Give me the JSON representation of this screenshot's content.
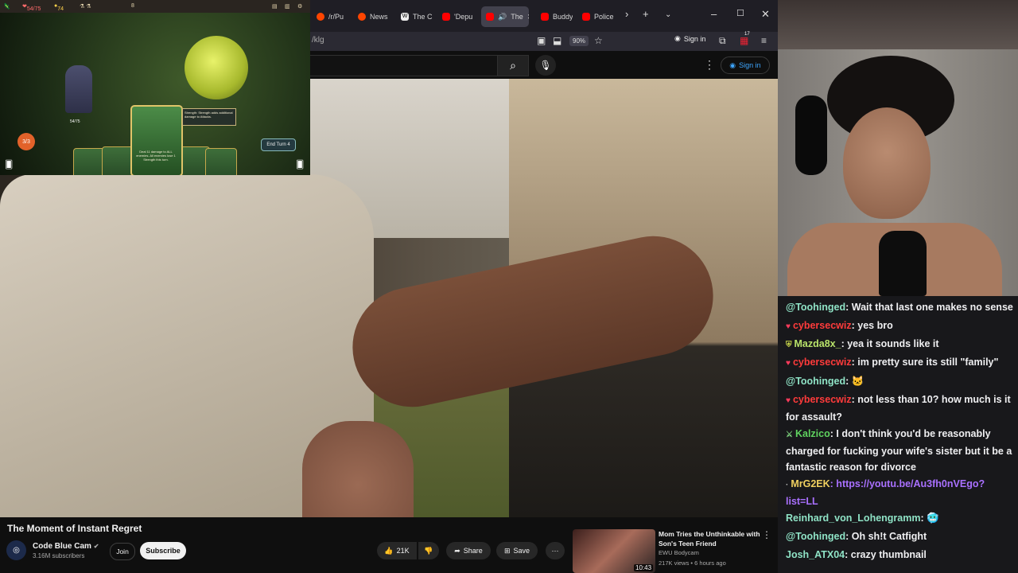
{
  "browser": {
    "tabs": [
      {
        "label": "/r/Pu",
        "icon": "reddit-icon"
      },
      {
        "label": "News",
        "icon": "reddit-icon"
      },
      {
        "label": "The C",
        "icon": "wikipedia-icon"
      },
      {
        "label": "'Depu",
        "icon": "youtube-icon"
      },
      {
        "label": "The",
        "icon": "youtube-icon",
        "active": true
      },
      {
        "label": "Buddy",
        "icon": "youtube-icon"
      },
      {
        "label": "Police",
        "icon": "youtube-icon"
      }
    ],
    "url_fragment": "/klg",
    "zoom": "90%",
    "sign_in": "Sign in",
    "notification_count": "17"
  },
  "youtube": {
    "sign_in": "Sign in",
    "video": {
      "title": "The Moment of Instant Regret",
      "channel": "Code Blue Cam",
      "subscribers": "3.16M subscribers",
      "join": "Join",
      "subscribe": "Subscribe",
      "likes": "21K",
      "share": "Share",
      "save": "Save"
    },
    "recommended": {
      "title": "Mom Tries the Unthinkable with Son's Teen Friend",
      "channel": "EWU Bodycam",
      "meta": "217K views • 6 hours ago",
      "duration": "10:43"
    }
  },
  "game": {
    "hp": "54/75",
    "gold": "74",
    "potions": "8",
    "energy": "3/3",
    "player_hp": "54/75",
    "end_turn": "End Turn",
    "end_turn_count": "4",
    "tooltip": "Strength: Strength adds additional damage to Attacks.",
    "card_text": "Deal 11 damage to ALL enemies. All enemies lose 1 Strength this turn."
  },
  "chat": [
    {
      "user": "@Toohinged",
      "text": ": Wait that last one makes no sense",
      "color": "#8fe3c6",
      "badge": ""
    },
    {
      "user": "cybersecwiz",
      "text": ": yes bro",
      "color": "#ff3b3b",
      "badge": "heart"
    },
    {
      "user": "Mazda8x_",
      "text": ": yea it sounds like it",
      "color": "#b9e36a",
      "badge": "shield"
    },
    {
      "user": "cybersecwiz",
      "text": ": im pretty sure its still \"family\"",
      "color": "#ff3b3b",
      "badge": "heart"
    },
    {
      "user": "@Toohinged",
      "text": ": 🐱",
      "color": "#8fe3c6",
      "badge": ""
    },
    {
      "user": "cybersecwiz",
      "text": ": not less than 10? how much is it for assault?",
      "color": "#ff3b3b",
      "badge": "heart"
    },
    {
      "user": "Kalzico",
      "text": ": I don't think you'd be reasonably charged for fucking your wife's sister but it be a fantastic reason for divorce",
      "color": "#5fd35f",
      "badge": "sword"
    },
    {
      "user": "MrG2EK",
      "text": ": https://youtu.be/Au3fh0nVEgo?list=LL",
      "color": "#f0d060",
      "badge": "dot"
    },
    {
      "user": "Reinhard_von_Lohengramm",
      "text": ": 🥶",
      "color": "#8fe3c6",
      "badge": ""
    },
    {
      "user": "@Toohinged",
      "text": ": Oh sh!t Catfight",
      "color": "#8fe3c6",
      "badge": ""
    },
    {
      "user": "Josh_ATX04",
      "text": ": crazy thumbnail",
      "color": "#8fe3c6",
      "badge": ""
    }
  ]
}
